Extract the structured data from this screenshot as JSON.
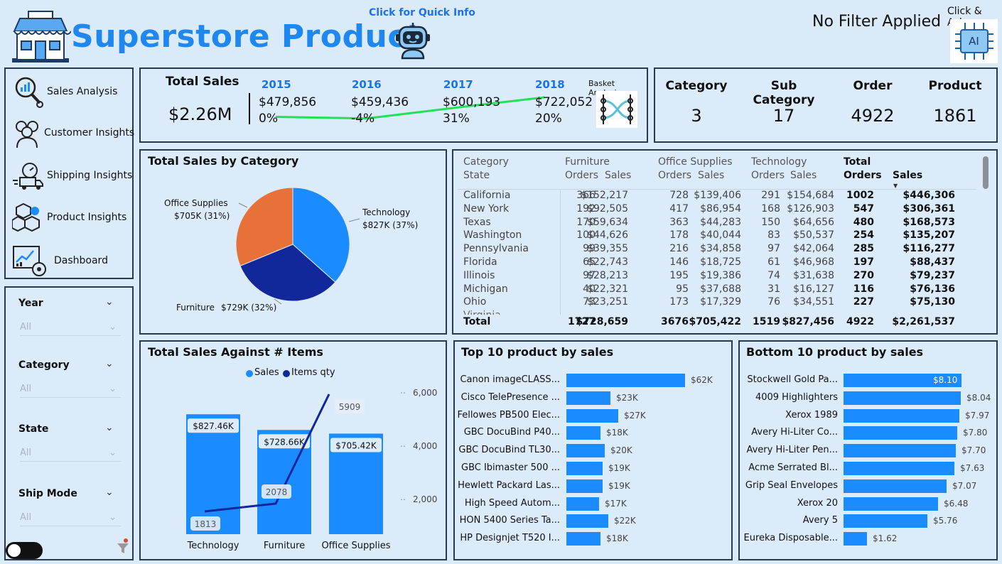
{
  "header": {
    "title": "Superstore Product",
    "quick_info": "Click for Quick Info",
    "filter_status": "No Filter Applied",
    "click_ask": "Click & Ask",
    "ai_label": "AI"
  },
  "nav": {
    "items": [
      {
        "label": "Sales Analysis",
        "icon": "magnifier-chart-icon"
      },
      {
        "label": "Customer Insights",
        "icon": "users-icon"
      },
      {
        "label": "Shipping Insights",
        "icon": "delivery-truck-icon"
      },
      {
        "label": "Product Insights",
        "icon": "boxes-icon"
      },
      {
        "label": "Dashboard",
        "icon": "dashboard-icon"
      }
    ]
  },
  "slicers": [
    {
      "label": "Year",
      "value": "All"
    },
    {
      "label": "Category",
      "value": "All"
    },
    {
      "label": "State",
      "value": "All"
    },
    {
      "label": "Ship Mode",
      "value": "All"
    }
  ],
  "kpi": {
    "total_label": "Total Sales",
    "total_value": "$2.26M",
    "basket_label": "Basket Analysis",
    "years": [
      {
        "year": "2015",
        "value": "$479,856",
        "pct": "0%"
      },
      {
        "year": "2016",
        "value": "$459,436",
        "pct": "-4%"
      },
      {
        "year": "2017",
        "value": "$600,193",
        "pct": "31%"
      },
      {
        "year": "2018",
        "value": "$722,052",
        "pct": "20%"
      }
    ],
    "trend_color": "#22e05a"
  },
  "counts": [
    {
      "label": "Category",
      "value": "3"
    },
    {
      "label": "Sub Category",
      "value": "17"
    },
    {
      "label": "Order",
      "value": "4922"
    },
    {
      "label": "Product",
      "value": "1861"
    }
  ],
  "category_pie": {
    "title": "Total Sales by Category",
    "slices": [
      {
        "label": "Technology",
        "value_label": "$827K (37%)",
        "value": 827,
        "color": "#1a8cff"
      },
      {
        "label": "Furniture",
        "value_label": "$729K (32%)",
        "value": 729,
        "color": "#12279a"
      },
      {
        "label": "Office Supplies",
        "value_label": "$705K (31%)",
        "value": 705,
        "color": "#e8713a"
      }
    ]
  },
  "matrix": {
    "headers": {
      "row1": [
        "Category",
        "Furniture",
        "Office Supplies",
        "Technology",
        "Total"
      ],
      "row2": [
        "State",
        "Orders",
        "Sales",
        "Orders",
        "Sales",
        "Orders",
        "Sales",
        "Orders",
        "Sales"
      ]
    },
    "rows": [
      [
        "California",
        "366",
        "$152,217",
        "728",
        "$139,406",
        "291",
        "$154,684",
        "1002",
        "$446,306"
      ],
      [
        "New York",
        "192",
        "$92,505",
        "417",
        "$86,954",
        "168",
        "$126,903",
        "547",
        "$306,361"
      ],
      [
        "Texas",
        "170",
        "$59,634",
        "363",
        "$44,283",
        "150",
        "$64,656",
        "480",
        "$168,573"
      ],
      [
        "Washington",
        "100",
        "$44,626",
        "178",
        "$40,044",
        "83",
        "$50,537",
        "254",
        "$135,207"
      ],
      [
        "Pennsylvania",
        "99",
        "$39,355",
        "216",
        "$34,858",
        "97",
        "$42,064",
        "285",
        "$116,277"
      ],
      [
        "Florida",
        "65",
        "$22,743",
        "146",
        "$18,725",
        "61",
        "$46,968",
        "197",
        "$88,437"
      ],
      [
        "Illinois",
        "97",
        "$28,213",
        "195",
        "$19,386",
        "74",
        "$31,638",
        "270",
        "$79,237"
      ],
      [
        "Michigan",
        "40",
        "$22,321",
        "95",
        "$37,688",
        "31",
        "$16,127",
        "116",
        "$76,136"
      ],
      [
        "Ohio",
        "73",
        "$23,251",
        "173",
        "$17,329",
        "76",
        "$34,551",
        "227",
        "$75,130"
      ]
    ],
    "total": [
      "Total",
      "1727",
      "$728,659",
      "3676",
      "$705,422",
      "1519",
      "$827,456",
      "4922",
      "$2,261,537"
    ]
  },
  "combo": {
    "title": "Total Sales Against # Items",
    "legend": [
      "Sales",
      "Items qty"
    ],
    "categories": [
      "Technology",
      "Furniture",
      "Office Supplies"
    ],
    "sales_labels": [
      "$827.46K",
      "$728.66K",
      "$705.42K"
    ],
    "sales": [
      827.46,
      728.66,
      705.42
    ],
    "qty": [
      1813,
      2078,
      5909
    ],
    "qty_labels": [
      "1813",
      "2078",
      "5909"
    ],
    "y_ticks": [
      "6,000",
      "4,000",
      "2,000"
    ]
  },
  "top10": {
    "title": "Top 10 product by sales",
    "items": [
      {
        "label": "Canon imageCLASS...",
        "value": 62,
        "value_label": "$62K"
      },
      {
        "label": "Cisco TelePresence ...",
        "value": 23,
        "value_label": "$23K"
      },
      {
        "label": "Fellowes PB500 Elec...",
        "value": 27,
        "value_label": "$27K"
      },
      {
        "label": "GBC DocuBind P40...",
        "value": 18,
        "value_label": "$18K"
      },
      {
        "label": "GBC DocuBind TL30...",
        "value": 20,
        "value_label": "$20K"
      },
      {
        "label": "GBC Ibimaster 500 ...",
        "value": 19,
        "value_label": "$19K"
      },
      {
        "label": "Hewlett Packard Las...",
        "value": 19,
        "value_label": "$19K"
      },
      {
        "label": "High Speed Autom...",
        "value": 17,
        "value_label": "$17K"
      },
      {
        "label": "HON 5400 Series Ta...",
        "value": 22,
        "value_label": "$22K"
      },
      {
        "label": "HP Designjet T520 I...",
        "value": 18,
        "value_label": "$18K"
      }
    ]
  },
  "bottom10": {
    "title": "Bottom 10 product by sales",
    "items": [
      {
        "label": "Stockwell Gold Pa...",
        "value": 8.1,
        "value_label": "$8.10"
      },
      {
        "label": "4009 Highlighters",
        "value": 8.04,
        "value_label": "$8.04"
      },
      {
        "label": "Xerox 1989",
        "value": 7.97,
        "value_label": "$7.97"
      },
      {
        "label": "Avery Hi-Liter Co...",
        "value": 7.8,
        "value_label": "$7.80"
      },
      {
        "label": "Avery Hi-Liter Pen...",
        "value": 7.7,
        "value_label": "$7.70"
      },
      {
        "label": "Acme Serrated Bl...",
        "value": 7.63,
        "value_label": "$7.63"
      },
      {
        "label": "Grip Seal Envelopes",
        "value": 7.07,
        "value_label": "$7.07"
      },
      {
        "label": "Xerox 20",
        "value": 6.48,
        "value_label": "$6.48"
      },
      {
        "label": "Avery 5",
        "value": 5.76,
        "value_label": "$5.76"
      },
      {
        "label": "Eureka Disposable...",
        "value": 1.62,
        "value_label": "$1.62"
      }
    ]
  }
}
